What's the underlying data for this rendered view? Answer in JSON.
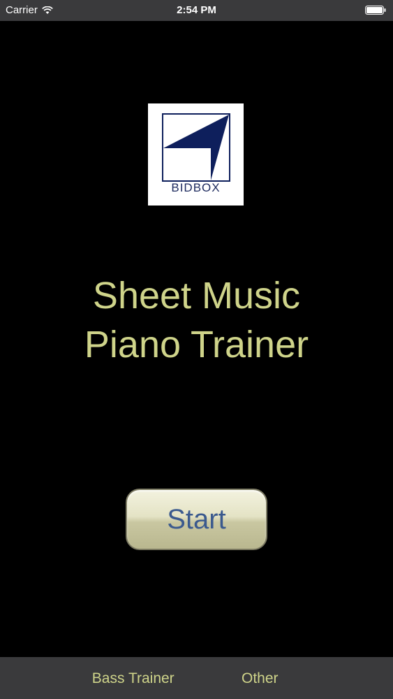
{
  "status_bar": {
    "carrier": "Carrier",
    "time": "2:54 PM",
    "wifi_icon": "wifi-icon",
    "battery_icon": "battery-icon"
  },
  "logo": {
    "text": "BIDBOX",
    "icon": "bidbox-logo",
    "accent_color": "#0e1f5c"
  },
  "title": {
    "line1": "Sheet Music",
    "line2": "Piano Trainer"
  },
  "start_button": {
    "label": "Start"
  },
  "tab_bar": {
    "items": [
      {
        "label": "Bass Trainer"
      },
      {
        "label": "Other"
      }
    ]
  },
  "colors": {
    "background": "#000000",
    "title_text": "#cfd48a",
    "bar_background": "#3a3a3c",
    "button_text": "#3b5a8e"
  }
}
